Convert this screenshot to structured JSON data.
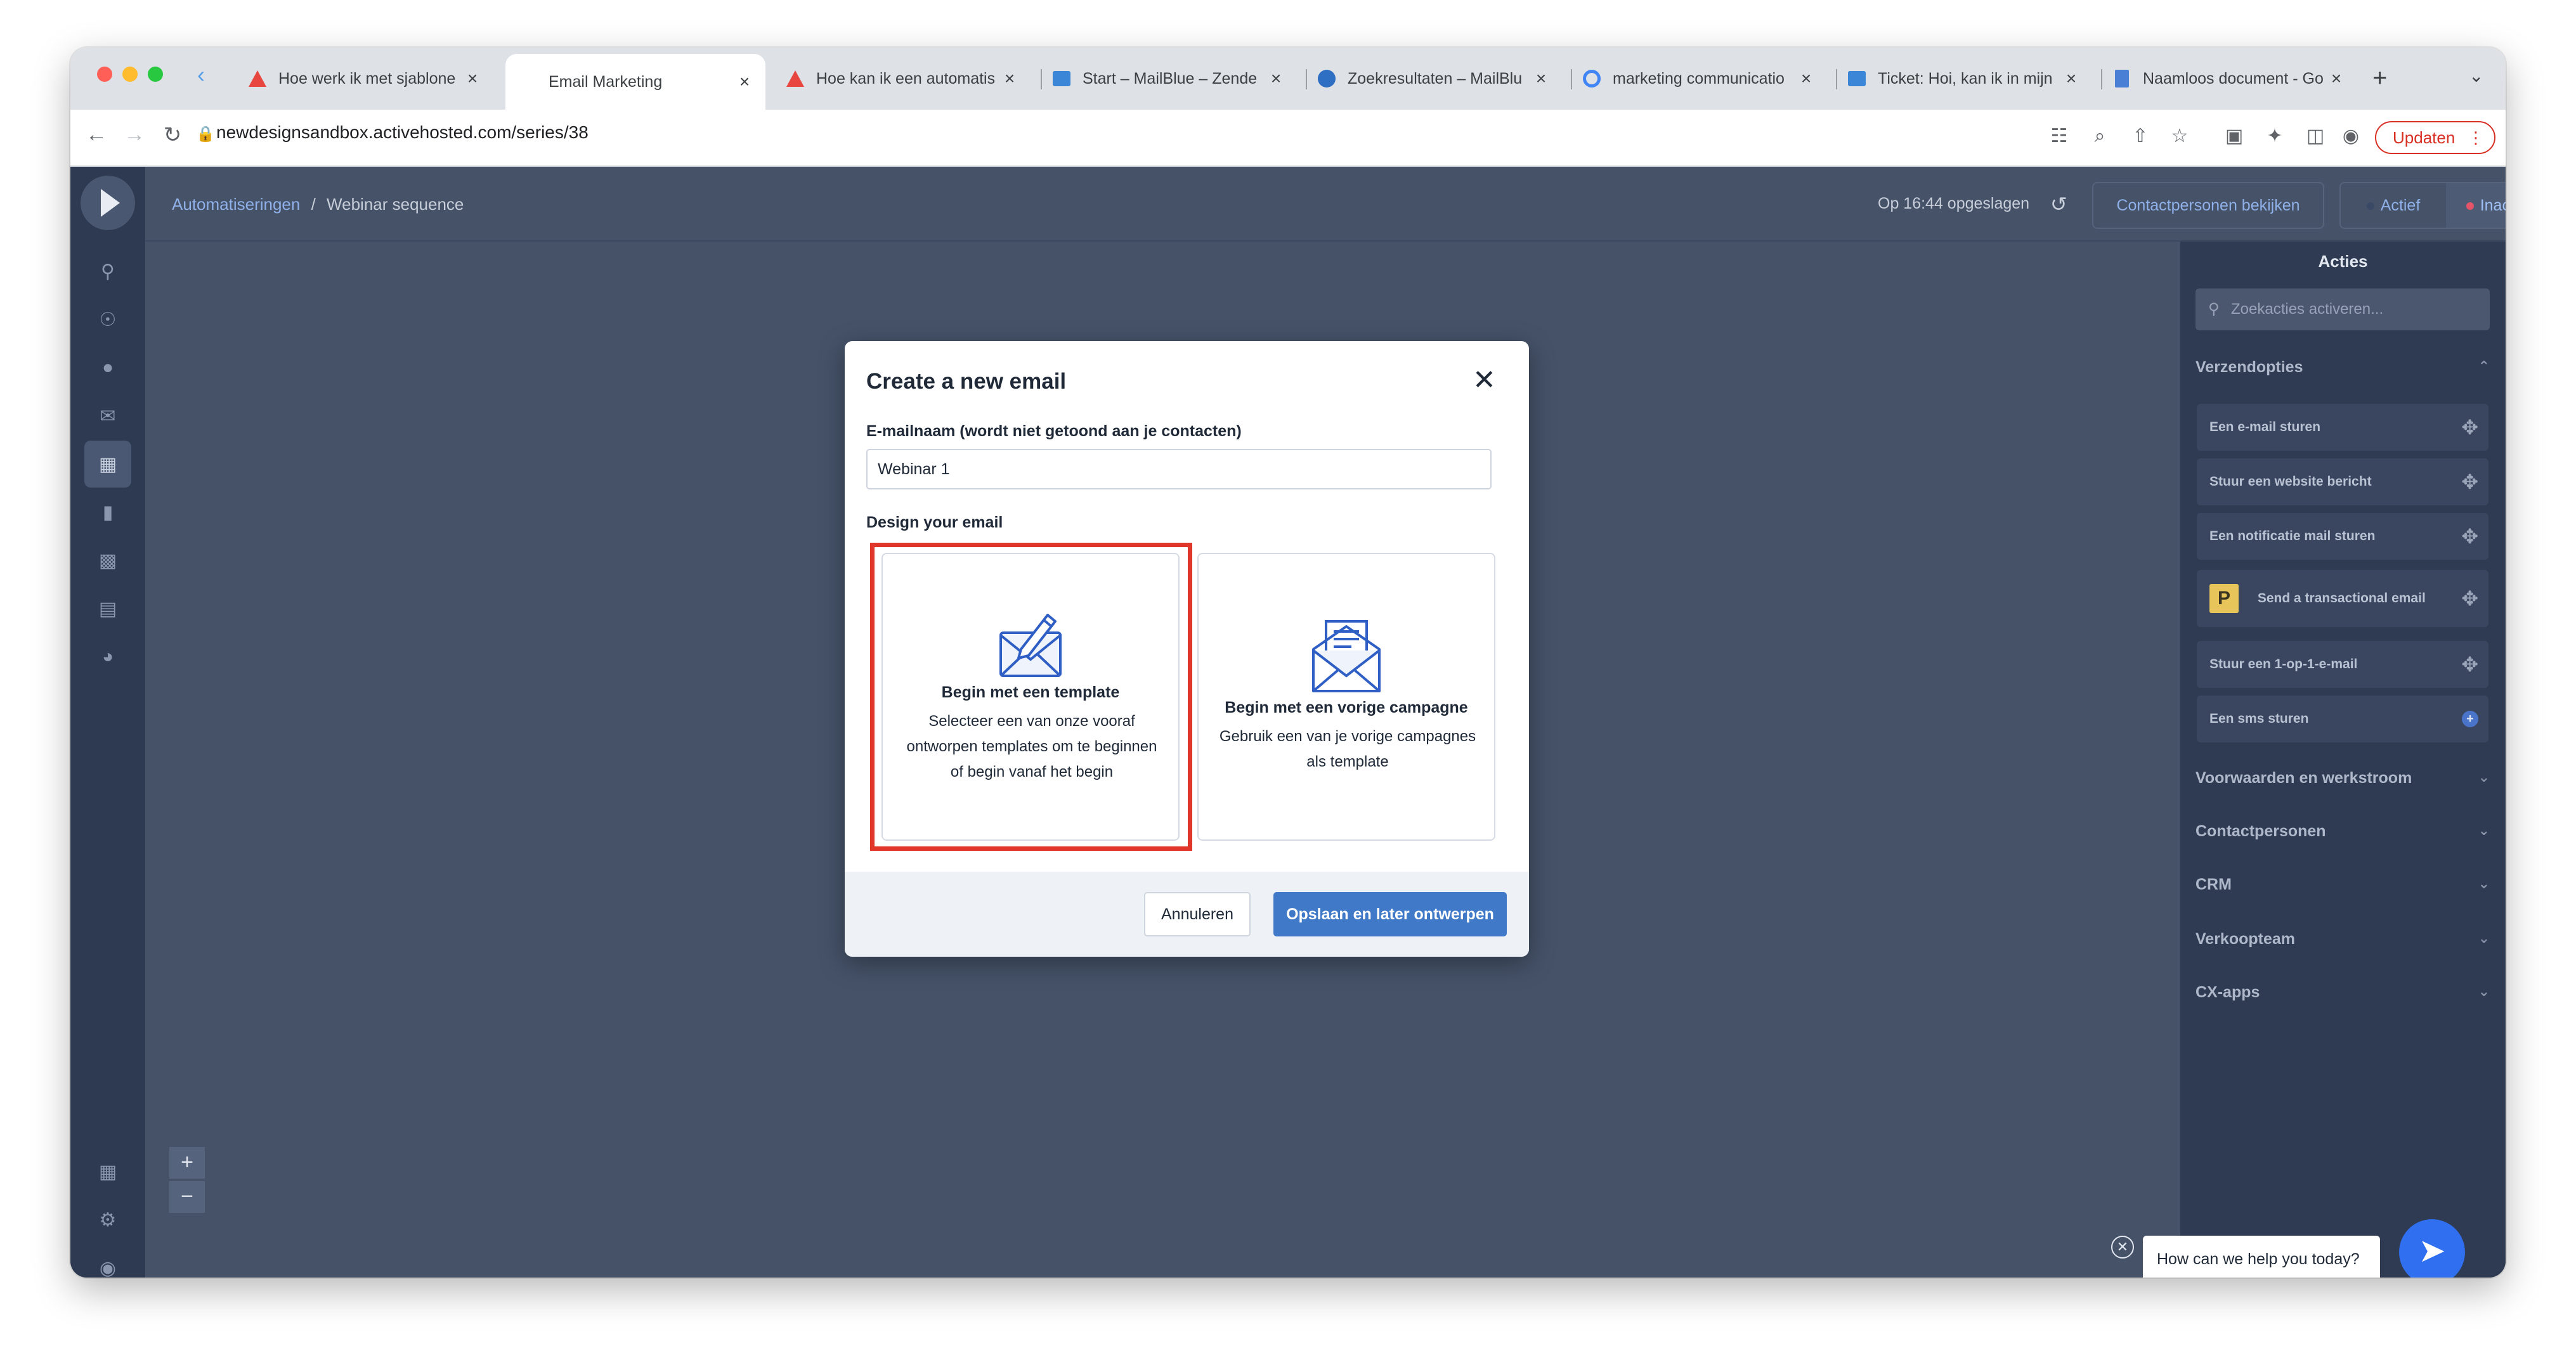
{
  "browser": {
    "tabs": [
      {
        "label": "Hoe werk ik met sjablone",
        "icon": "warning-triangle-icon"
      },
      {
        "label": "Email Marketing",
        "icon": "none",
        "active": true
      },
      {
        "label": "Hoe kan ik een automatis",
        "icon": "warning-triangle-icon"
      },
      {
        "label": "Start – MailBlue – Zende",
        "icon": "square-icon"
      },
      {
        "label": "Zoekresultaten – MailBlu",
        "icon": "circle-icon"
      },
      {
        "label": "marketing communicatio",
        "icon": "google-icon"
      },
      {
        "label": "Ticket: Hoi, kan ik in mijn",
        "icon": "square-icon"
      },
      {
        "label": "Naamloos document - Go",
        "icon": "doc-icon"
      }
    ],
    "url": "newdesignsandbox.activehosted.com/series/38",
    "update_label": "Updaten"
  },
  "app": {
    "breadcrumb": {
      "parent": "Automatiseringen",
      "separator": "/",
      "current": "Webinar sequence"
    },
    "saved_text": "Op 16:44 opgeslagen",
    "view_contacts": "Contactpersonen bekijken",
    "status": {
      "active": "Actief",
      "inactive": "Inactief"
    },
    "colors": {
      "active_dot": "#3a4a66",
      "inactive_dot": "#e45468",
      "accent": "#3f79c7"
    },
    "zoom": {
      "in": "+",
      "out": "−"
    }
  },
  "panel": {
    "title": "Acties",
    "search_placeholder": "Zoekacties activeren...",
    "sections": {
      "verzend": "Verzendopties",
      "voorwaarden": "Voorwaarden en werkstroom",
      "contact": "Contactpersonen",
      "crm": "CRM",
      "verkoop": "Verkoopteam",
      "cx": "CX-apps"
    },
    "items": [
      "Een e-mail sturen",
      "Stuur een website bericht",
      "Een notificatie mail sturen",
      "Send a transactional email",
      "Stuur een 1-op-1-e-mail",
      "Een sms sturen"
    ],
    "p_badge": "P"
  },
  "modal": {
    "title": "Create a new email",
    "name_label": "E-mailnaam (wordt niet getoond aan je contacten)",
    "name_value": "Webinar 1",
    "design_label": "Design your email",
    "options": [
      {
        "title": "Begin met een template",
        "description": "Selecteer een van onze vooraf ontworpen templates om te beginnen of begin vanaf het begin"
      },
      {
        "title": "Begin met een vorige campagne",
        "description": "Gebruik een van je vorige campagnes als template"
      }
    ],
    "cancel": "Annuleren",
    "save": "Opslaan en later ontwerpen"
  },
  "chat": {
    "prompt": "How can we help you today?"
  }
}
